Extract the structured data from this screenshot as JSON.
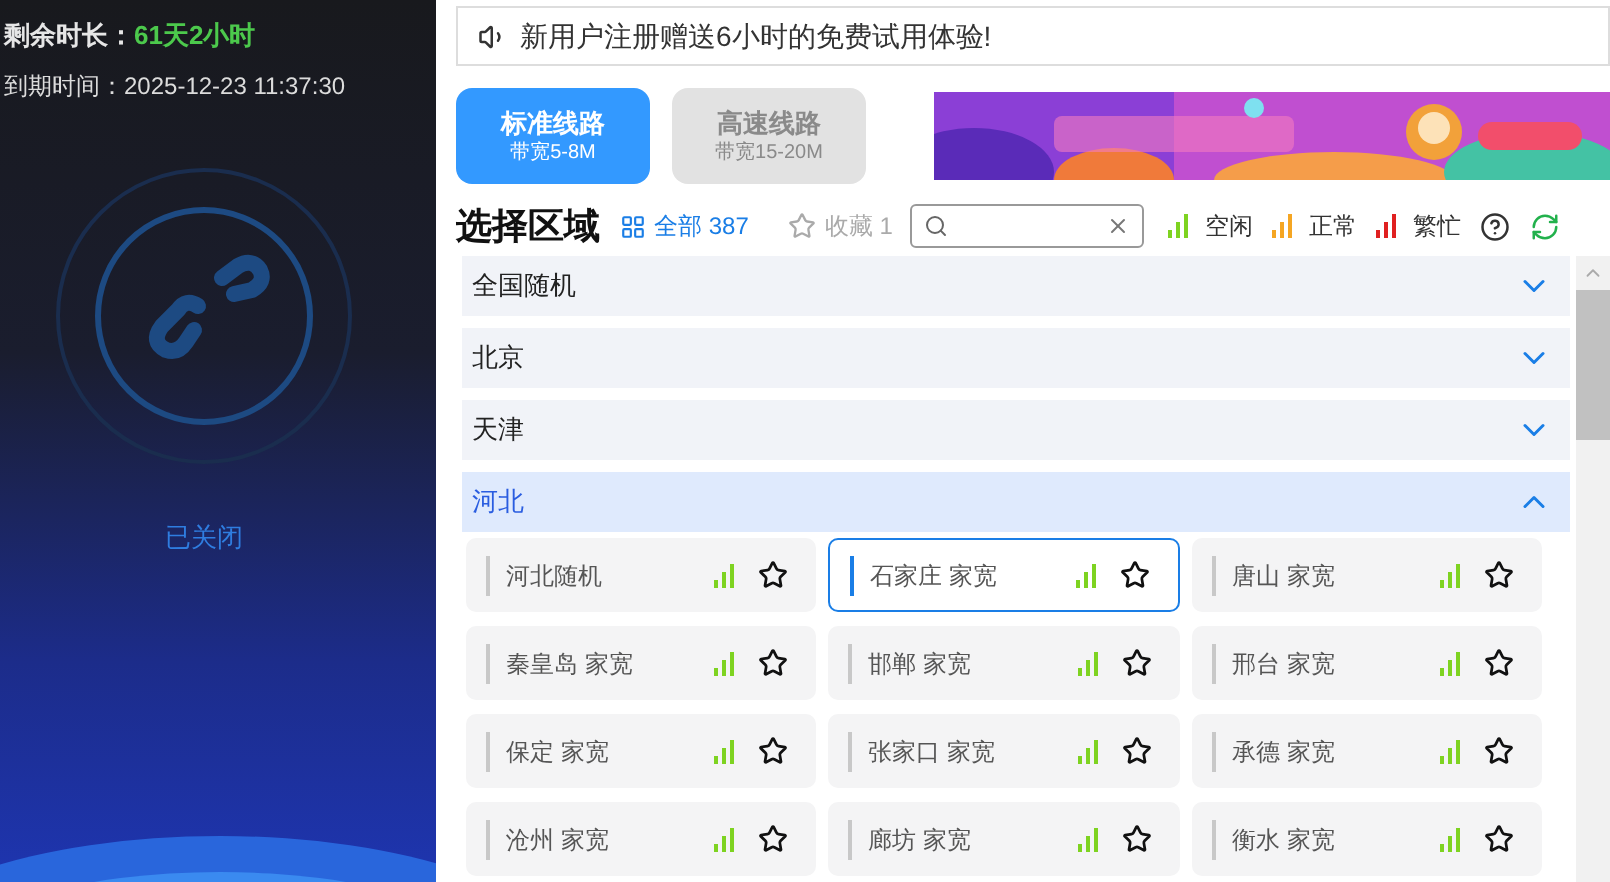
{
  "account": {
    "remaining_label": "剩余时长：",
    "remaining_value": "61天2小时",
    "expiry_label": "到期时间：",
    "expiry_value": "2025-12-23 11:37:30"
  },
  "connection": {
    "status": "已关闭",
    "connected": false
  },
  "notice": "新用户注册赠送6小时的免费试用体验!",
  "lines": [
    {
      "name": "标准线路",
      "bandwidth": "带宽5-8M",
      "selected": true
    },
    {
      "name": "高速线路",
      "bandwidth": "带宽15-20M",
      "selected": false
    }
  ],
  "region_header": {
    "title": "选择区域",
    "all_label": "全部",
    "all_count": "387",
    "favorites_label": "收藏",
    "favorites_count": "1"
  },
  "legend": [
    {
      "label": "空闲",
      "color": "#7ed321"
    },
    {
      "label": "正常",
      "color": "#f5a623"
    },
    {
      "label": "繁忙",
      "color": "#e02020"
    }
  ],
  "regions": [
    {
      "name": "全国随机",
      "expanded": false
    },
    {
      "name": "北京",
      "expanded": false
    },
    {
      "name": "天津",
      "expanded": false
    },
    {
      "name": "河北",
      "expanded": true,
      "nodes": [
        {
          "name": "河北随机",
          "selected": false,
          "color": "#7ed321"
        },
        {
          "name": "石家庄 家宽",
          "selected": true,
          "color": "#7ed321"
        },
        {
          "name": "唐山 家宽",
          "selected": false,
          "color": "#7ed321"
        },
        {
          "name": "秦皇岛 家宽",
          "selected": false,
          "color": "#7ed321"
        },
        {
          "name": "邯郸 家宽",
          "selected": false,
          "color": "#7ed321"
        },
        {
          "name": "邢台 家宽",
          "selected": false,
          "color": "#7ed321"
        },
        {
          "name": "保定 家宽",
          "selected": false,
          "color": "#7ed321"
        },
        {
          "name": "张家口 家宽",
          "selected": false,
          "color": "#7ed321"
        },
        {
          "name": "承德 家宽",
          "selected": false,
          "color": "#7ed321"
        },
        {
          "name": "沧州 家宽",
          "selected": false,
          "color": "#7ed321"
        },
        {
          "name": "廊坊 家宽",
          "selected": false,
          "color": "#7ed321"
        },
        {
          "name": "衡水 家宽",
          "selected": false,
          "color": "#7ed321"
        }
      ]
    }
  ]
}
